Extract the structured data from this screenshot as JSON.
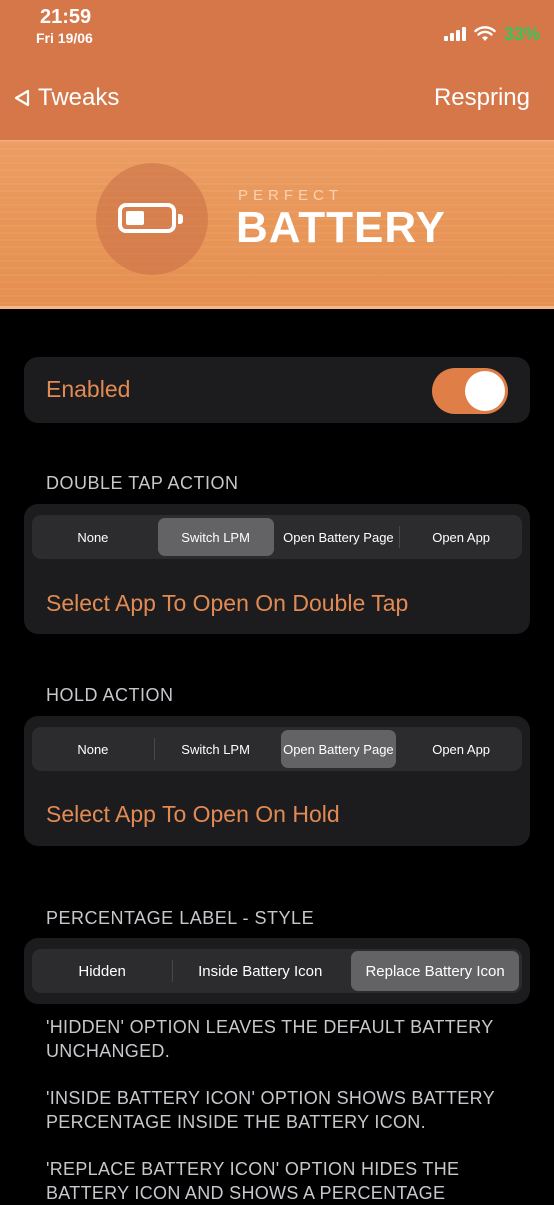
{
  "status": {
    "time": "21:59",
    "date": "Fri 19/06",
    "battery": "33%",
    "battery_color": "#34c759"
  },
  "nav": {
    "back_label": "Tweaks",
    "right_label": "Respring"
  },
  "banner": {
    "small": "PERFECT",
    "big": "BATTERY"
  },
  "enabled": {
    "label": "Enabled",
    "value": true
  },
  "double_tap": {
    "header": "DOUBLE TAP ACTION",
    "options": [
      "None",
      "Switch LPM",
      "Open Battery Page",
      "Open App"
    ],
    "selected": "Switch LPM",
    "link": "Select App To Open On Double Tap"
  },
  "hold": {
    "header": "HOLD ACTION",
    "options": [
      "None",
      "Switch LPM",
      "Open Battery Page",
      "Open App"
    ],
    "selected": "Open Battery Page",
    "link": "Select App To Open On Hold"
  },
  "percentage": {
    "header": "PERCENTAGE LABEL - STYLE",
    "options": [
      "Hidden",
      "Inside Battery Icon",
      "Replace Battery Icon"
    ],
    "selected": "Replace Battery Icon",
    "footer": [
      "'HIDDEN' OPTION LEAVES THE DEFAULT BATTERY UNCHANGED.",
      "'INSIDE BATTERY ICON' OPTION SHOWS BATTERY PERCENTAGE INSIDE THE BATTERY ICON.",
      "'REPLACE BATTERY ICON' OPTION HIDES THE BATTERY ICON AND SHOWS A PERCENTAGE"
    ]
  },
  "colors": {
    "accent": "#e28a54",
    "header_bg": "#d6774a",
    "card_bg": "#1c1c1e"
  }
}
